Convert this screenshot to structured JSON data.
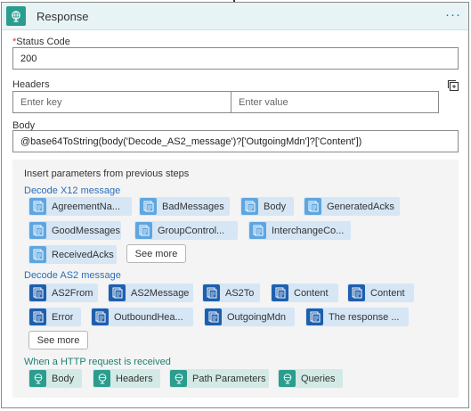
{
  "header": {
    "title": "Response",
    "more_label": "···"
  },
  "status_code": {
    "label": "Status Code",
    "required_mark": "*",
    "value": "200"
  },
  "headers": {
    "label": "Headers",
    "key_placeholder": "Enter key",
    "value_placeholder": "Enter value"
  },
  "body": {
    "label": "Body",
    "value": "@base64ToString(body('Decode_AS2_message')?['OutgoingMdn']?['Content'])"
  },
  "panel": {
    "title": "Insert parameters from previous steps",
    "x12": {
      "title": "Decode X12 message",
      "tokens": [
        "AgreementNa...",
        "BadMessages",
        "Body",
        "GeneratedAcks",
        "GoodMessages",
        "GroupControl...",
        "InterchangeCo...",
        "ReceivedAcks"
      ],
      "see_more": "See more"
    },
    "as2": {
      "title": "Decode AS2 message",
      "tokens": [
        "AS2From",
        "AS2Message",
        "AS2To",
        "Content",
        "Content",
        "Error",
        "OutboundHea...",
        "OutgoingMdn",
        "The response ..."
      ],
      "see_more": "See more"
    },
    "http": {
      "title": "When a HTTP request is received",
      "tokens": [
        "Body",
        "Headers",
        "Path Parameters",
        "Queries"
      ]
    }
  },
  "colors": {
    "x12_icon": "#5ea6e0",
    "as2_icon": "#1e5fae",
    "http_icon": "#2a9d8f",
    "link_blue": "#2a6ebb",
    "link_teal": "#1f7f72"
  },
  "icons": {
    "header": "globe-icon",
    "x12": "document-icon",
    "as2": "document-icon",
    "http": "globe-icon",
    "copy": "copy-icon"
  }
}
